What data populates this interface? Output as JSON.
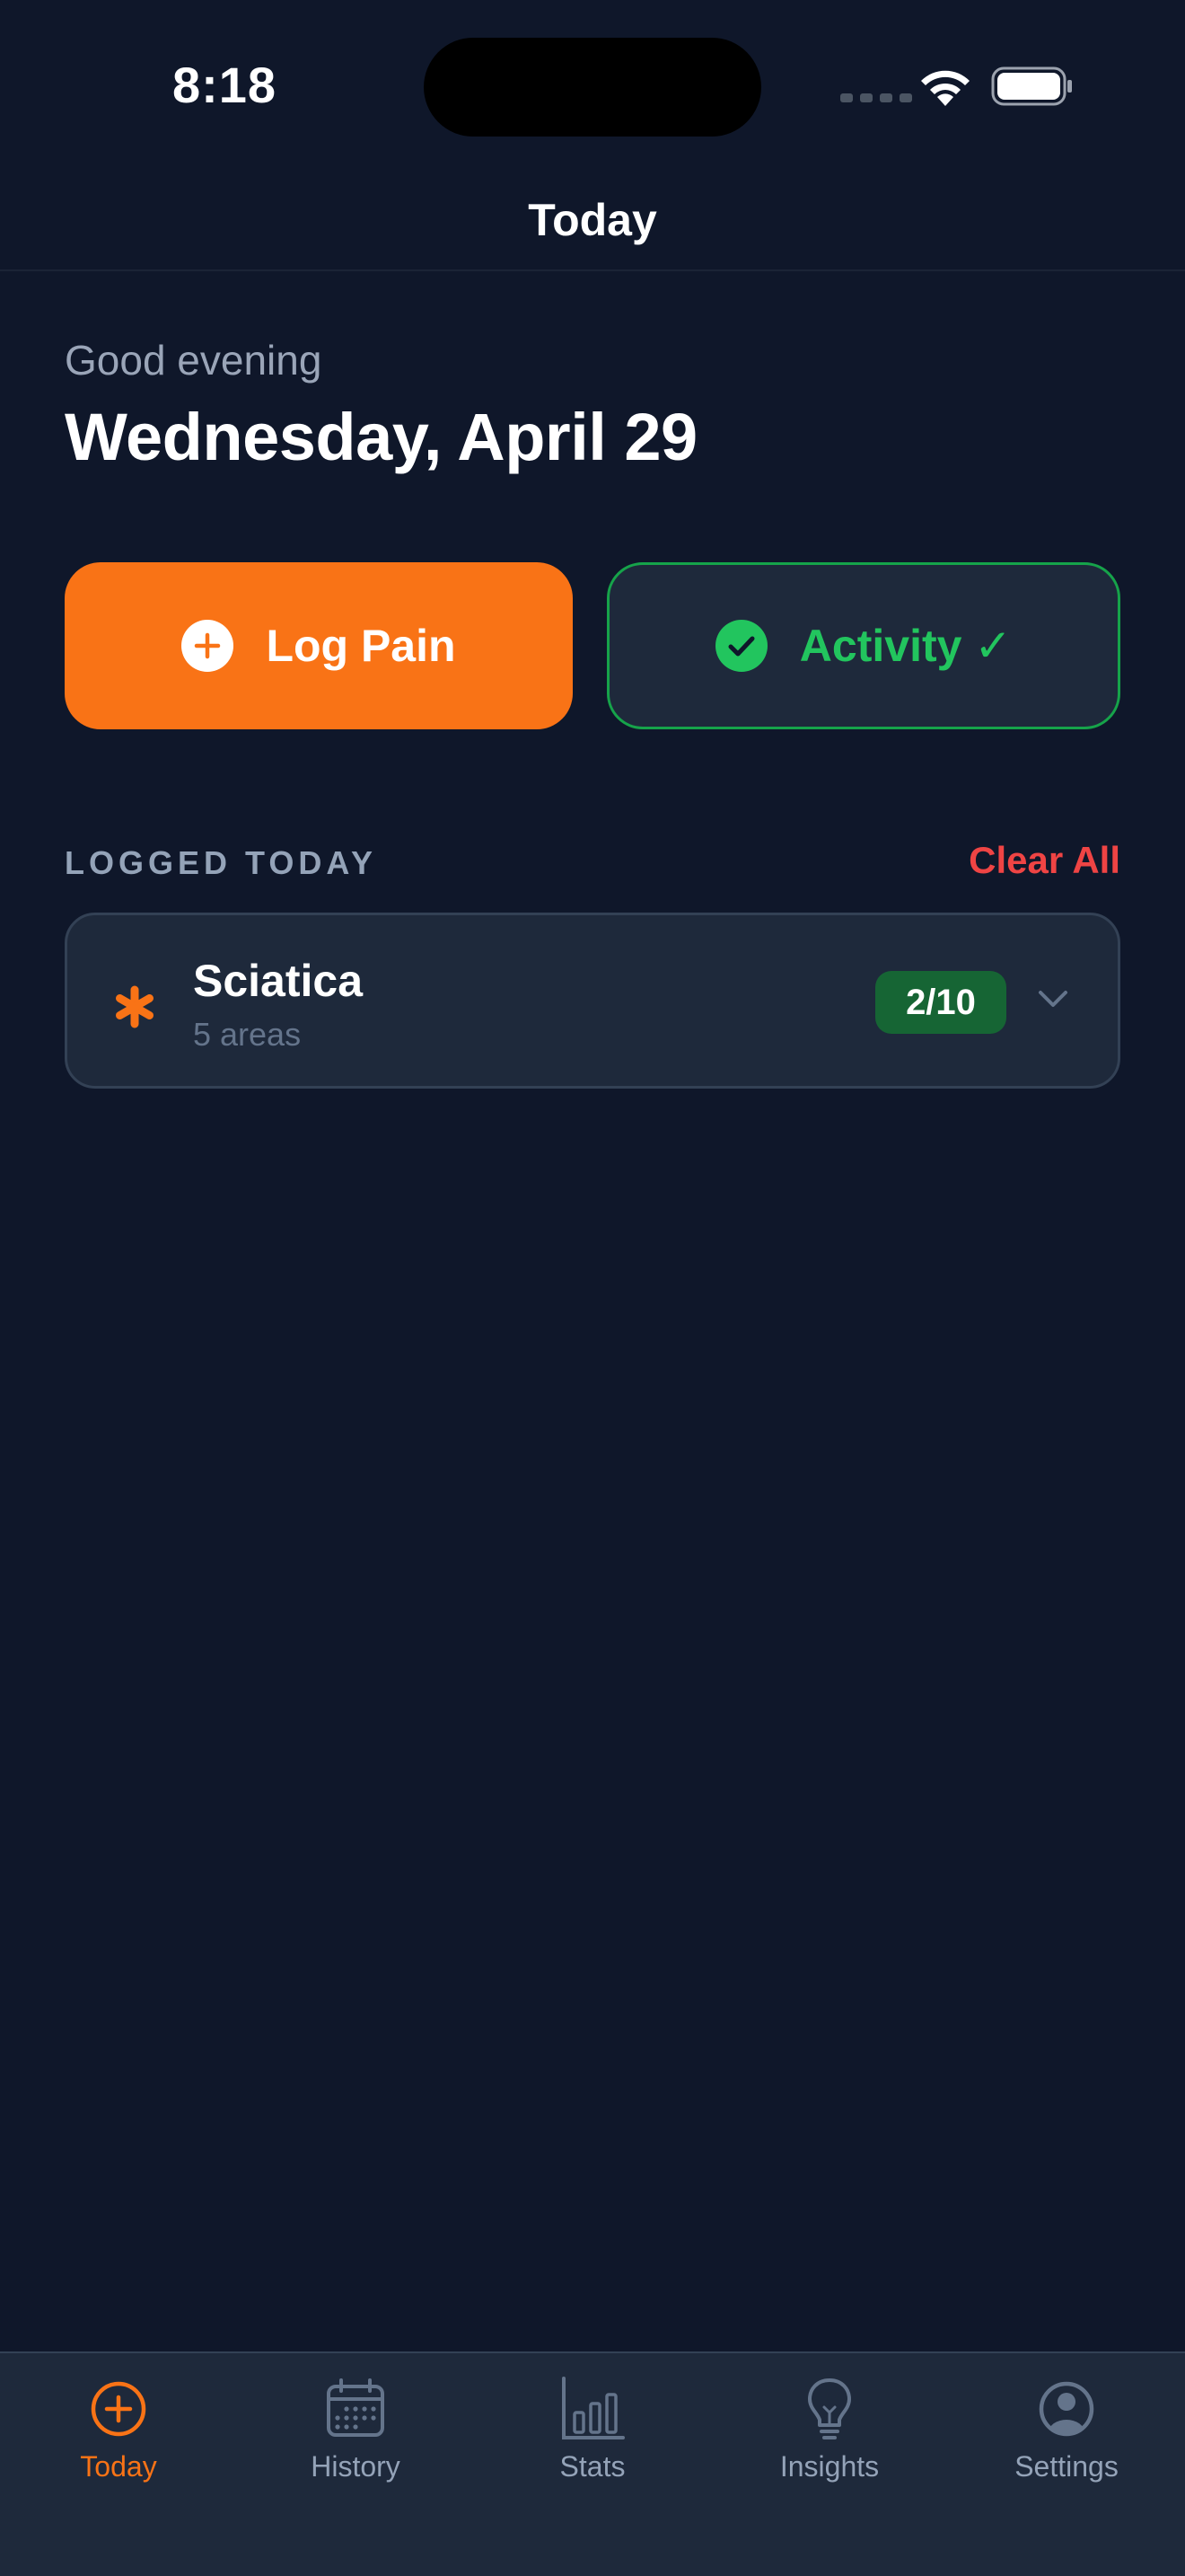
{
  "status_bar": {
    "time": "8:18"
  },
  "header": {
    "title": "Today"
  },
  "greeting": {
    "salutation": "Good evening",
    "date": "Wednesday, April 29"
  },
  "actions": {
    "log_pain_label": "Log Pain",
    "activity_label": "Activity ✓"
  },
  "logged_today": {
    "section_title": "LOGGED TODAY",
    "clear_all_label": "Clear All",
    "entries": [
      {
        "name": "Sciatica",
        "subtitle": "5 areas",
        "score": "2/10"
      }
    ]
  },
  "tab_bar": {
    "items": [
      {
        "label": "Today",
        "icon": "plus-circle-icon",
        "active": true
      },
      {
        "label": "History",
        "icon": "calendar-icon",
        "active": false
      },
      {
        "label": "Stats",
        "icon": "bar-chart-icon",
        "active": false
      },
      {
        "label": "Insights",
        "icon": "lightbulb-icon",
        "active": false
      },
      {
        "label": "Settings",
        "icon": "person-circle-icon",
        "active": false
      }
    ]
  },
  "colors": {
    "background": "#0f172a",
    "card": "#1e293b",
    "accent_orange": "#f97316",
    "accent_green": "#22c55e",
    "danger_red": "#ef4444",
    "badge_green": "#166534"
  }
}
